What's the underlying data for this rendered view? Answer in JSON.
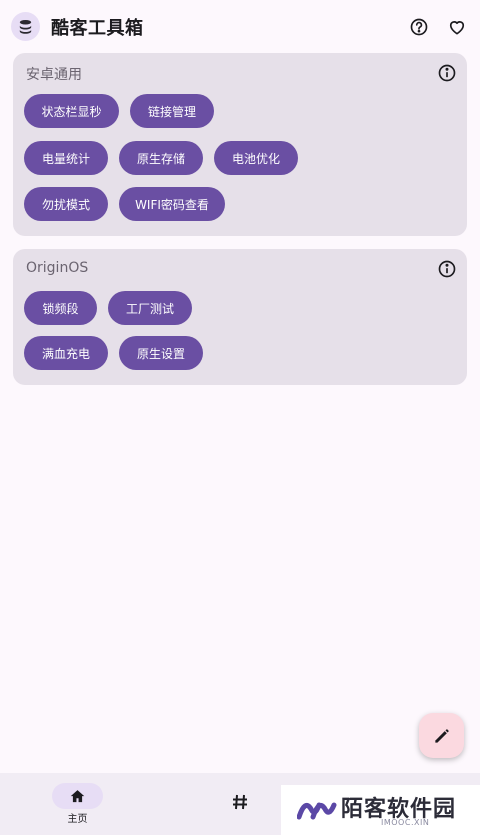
{
  "app": {
    "title": "酷客工具箱"
  },
  "sections": [
    {
      "title": "安卓通用",
      "buttons": [
        "状态栏显秒",
        "链接管理",
        "电量统计",
        "原生存储",
        "电池优化",
        "勿扰模式",
        "WIFI密码查看"
      ]
    },
    {
      "title": "OriginOS",
      "buttons": [
        "锁频段",
        "工厂测试",
        "满血充电",
        "原生设置"
      ]
    }
  ],
  "bottom_nav": {
    "home_label": "主页"
  },
  "watermark": {
    "title": "陌客软件园",
    "subtitle": "IMOOC.XIN"
  },
  "colors": {
    "accent": "#6a4fa3",
    "card": "#e6e0e9",
    "fab": "#fbd9e0",
    "background": "#fdf8fd"
  },
  "icons": {
    "logo": "stack-icon",
    "help": "help-circle-icon",
    "favorite": "heart-icon",
    "info": "info-icon",
    "edit": "pencil-icon",
    "home": "home-icon",
    "tag": "hash-icon"
  }
}
